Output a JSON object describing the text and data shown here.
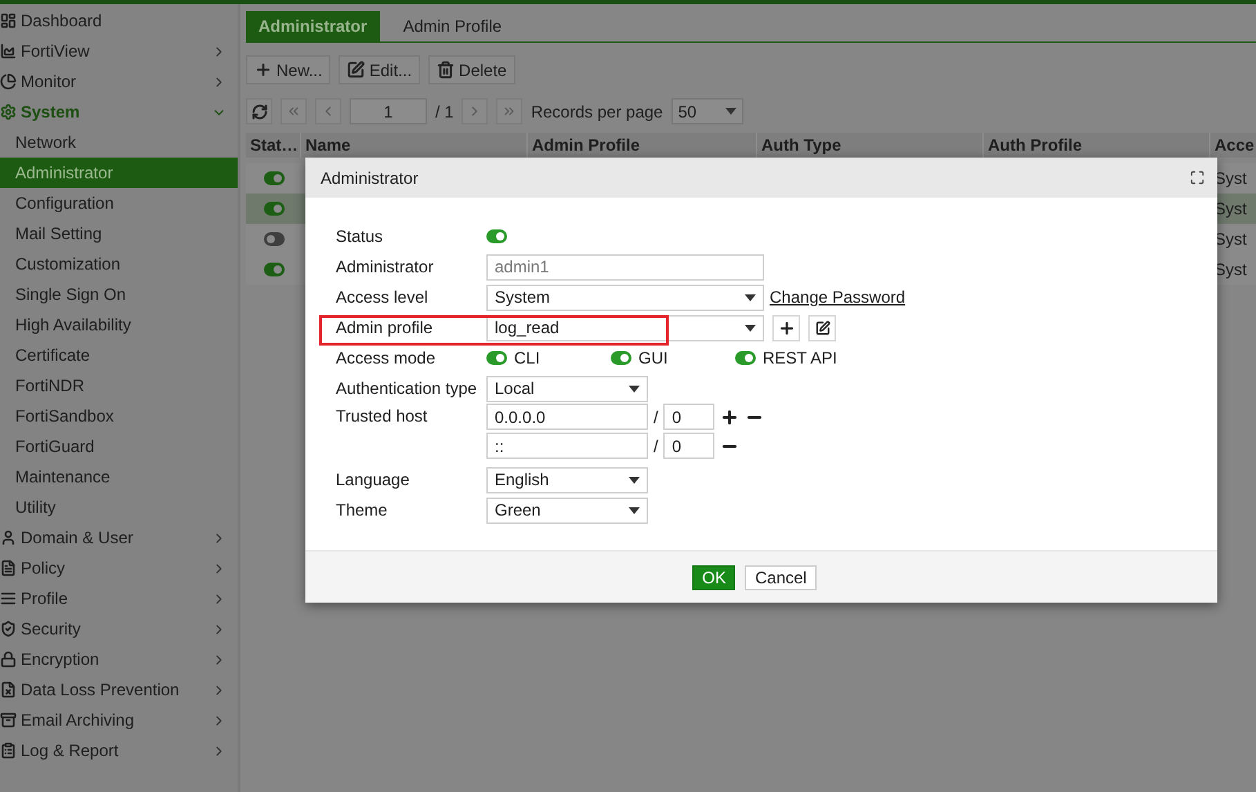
{
  "sidebar": {
    "items": [
      {
        "label": "Dashboard",
        "kind": "link",
        "selected": false
      },
      {
        "label": "FortiView",
        "kind": "group",
        "expanded": false,
        "selected": false
      },
      {
        "label": "Monitor",
        "kind": "group",
        "expanded": false,
        "selected": false
      },
      {
        "label": "System",
        "kind": "group",
        "expanded": true,
        "selected": false,
        "children": [
          {
            "label": "Network",
            "selected": false
          },
          {
            "label": "Administrator",
            "selected": true
          },
          {
            "label": "Configuration",
            "selected": false
          },
          {
            "label": "Mail Setting",
            "selected": false
          },
          {
            "label": "Customization",
            "selected": false
          },
          {
            "label": "Single Sign On",
            "selected": false
          },
          {
            "label": "High Availability",
            "selected": false
          },
          {
            "label": "Certificate",
            "selected": false
          },
          {
            "label": "FortiNDR",
            "selected": false
          },
          {
            "label": "FortiSandbox",
            "selected": false
          },
          {
            "label": "FortiGuard",
            "selected": false
          },
          {
            "label": "Maintenance",
            "selected": false
          },
          {
            "label": "Utility",
            "selected": false
          }
        ]
      },
      {
        "label": "Domain & User",
        "kind": "group",
        "expanded": false,
        "selected": false
      },
      {
        "label": "Policy",
        "kind": "group",
        "expanded": false,
        "selected": false
      },
      {
        "label": "Profile",
        "kind": "group",
        "expanded": false,
        "selected": false
      },
      {
        "label": "Security",
        "kind": "group",
        "expanded": false,
        "selected": false
      },
      {
        "label": "Encryption",
        "kind": "group",
        "expanded": false,
        "selected": false
      },
      {
        "label": "Data Loss Prevention",
        "kind": "group",
        "expanded": false,
        "selected": false
      },
      {
        "label": "Email Archiving",
        "kind": "group",
        "expanded": false,
        "selected": false
      },
      {
        "label": "Log & Report",
        "kind": "group",
        "expanded": false,
        "selected": false
      }
    ]
  },
  "tabs": [
    {
      "label": "Administrator",
      "selected": true
    },
    {
      "label": "Admin Profile",
      "selected": false
    }
  ],
  "toolbar": {
    "buttons": [
      "New...",
      "Edit...",
      "Delete"
    ]
  },
  "pager": {
    "page": "1",
    "total": "/ 1",
    "records_label": "Records per page",
    "records_per_page": "50"
  },
  "table": {
    "columns": [
      "Stat…",
      "Name",
      "Admin Profile",
      "Auth Type",
      "Auth Profile",
      "Acce"
    ],
    "rows": [
      {
        "on": true,
        "selected": false,
        "access": "Syst"
      },
      {
        "on": true,
        "selected": true,
        "access": "Syst"
      },
      {
        "on": false,
        "selected": false,
        "access": "Syst"
      },
      {
        "on": true,
        "selected": false,
        "access": "Syst"
      }
    ]
  },
  "dialog": {
    "title": "Administrator",
    "fields": [
      {
        "kind": "toggle",
        "label": "Status",
        "on": true
      },
      {
        "kind": "text",
        "label": "Administrator",
        "value": "admin1",
        "disabled": true
      },
      {
        "kind": "select",
        "label": "Access level",
        "value": "System",
        "link": "Change Password"
      },
      {
        "kind": "profile",
        "label": "Admin profile",
        "value": "log_read",
        "highlighted": true
      },
      {
        "kind": "toggles",
        "label": "Access mode",
        "options": [
          {
            "label": "CLI",
            "on": true
          },
          {
            "label": "GUI",
            "on": true
          },
          {
            "label": "REST API",
            "on": true
          }
        ]
      },
      {
        "kind": "short-select",
        "label": "Authentication type",
        "value": "Local"
      },
      {
        "kind": "hosts",
        "label": "Trusted host",
        "hosts": [
          {
            "address": "0.0.0.0",
            "separator": "/",
            "mask": "0",
            "can_add": true
          },
          {
            "address": "::",
            "separator": "/",
            "mask": "0",
            "can_add": false
          }
        ]
      },
      {
        "kind": "short-select",
        "label": "Language",
        "value": "English"
      },
      {
        "kind": "short-select",
        "label": "Theme",
        "value": "Green"
      }
    ],
    "buttons": [
      {
        "label": "OK",
        "primary": true
      },
      {
        "label": "Cancel",
        "primary": false
      }
    ]
  }
}
